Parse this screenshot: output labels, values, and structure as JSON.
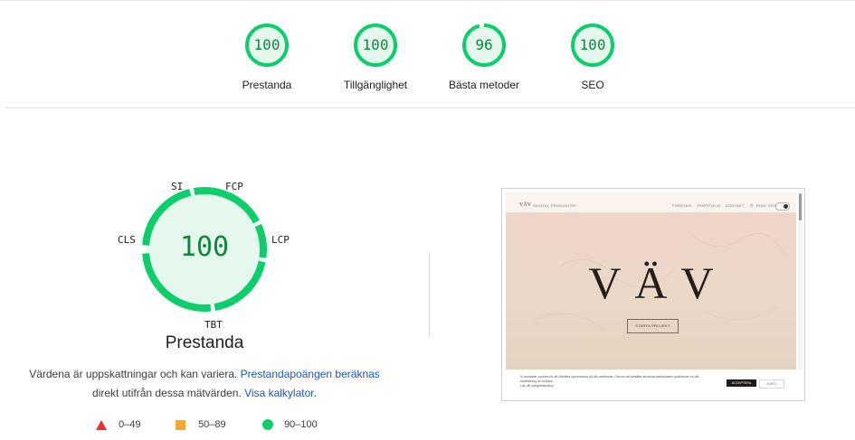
{
  "colors": {
    "pass": "#0cce6b",
    "pass_text": "#0b8a3c",
    "pass_bg": "#e6f7ed",
    "average": "#f8a72c",
    "fail": "#eb2f2f",
    "link": "#1a55c8"
  },
  "summary": [
    {
      "score": "100",
      "label": "Prestanda",
      "fraction": 1.0
    },
    {
      "score": "100",
      "label": "Tillgänglighet",
      "fraction": 1.0
    },
    {
      "score": "96",
      "label": "Bästa metoder",
      "fraction": 0.96
    },
    {
      "score": "100",
      "label": "SEO",
      "fraction": 1.0
    }
  ],
  "performance": {
    "score": "100",
    "title": "Prestanda",
    "metrics": [
      "SI",
      "FCP",
      "LCP",
      "TBT",
      "CLS"
    ],
    "description_prefix": "Värdena är uppskattningar och kan variera.",
    "description_link1": "Prestandapoängen beräknas",
    "description_mid": "direkt utifrån dessa mätvärden.",
    "description_link2": "Visa kalkylator",
    "description_suffix": "."
  },
  "legend": [
    {
      "range": "0–49",
      "icon": "triangle-icon"
    },
    {
      "range": "50–89",
      "icon": "square-icon"
    },
    {
      "range": "90–100",
      "icon": "circle-icon"
    }
  ],
  "screenshot": {
    "brand": "VÄV",
    "tagline": "DIGITAL PRODUKTER",
    "nav": [
      "FÖRETAG",
      "PORTFOLIO",
      "KONTAKT"
    ],
    "phone": "RING OSS",
    "hero_title": "VÄV",
    "hero_button": "STARTA PROJEKT",
    "cookie_line1": "Vi använder cookies för att förbättra upplevelsen på vår webbplats. Genom att fortsätta använda webbplatsen godkänner du vår",
    "cookie_line2": "användning av cookies.",
    "cookie_link": "Läs vår integritetspolicy",
    "accept_label": "ACCEPTERA",
    "reject_label": "AVBÖJ"
  }
}
